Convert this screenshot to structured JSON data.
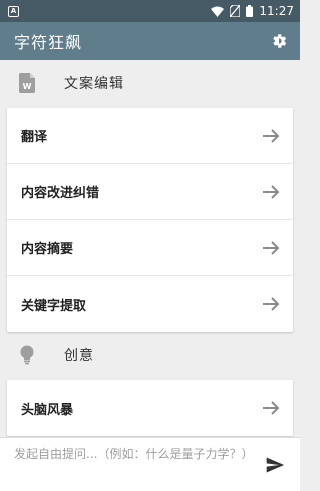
{
  "status_bar": {
    "notification_icon": "A",
    "time": "11:27"
  },
  "app_bar": {
    "title": "字符狂飙",
    "settings_icon": "settings-gear-icon"
  },
  "sections": [
    {
      "title": "文案编辑",
      "icon": "word-document-icon",
      "items": [
        {
          "label": "翻译"
        },
        {
          "label": "内容改进纠错"
        },
        {
          "label": "内容摘要"
        },
        {
          "label": "关键字提取"
        }
      ]
    },
    {
      "title": "创意",
      "icon": "lightbulb-icon",
      "items": [
        {
          "label": "头脑风暴"
        }
      ]
    }
  ],
  "bottom_input": {
    "placeholder": "发起自由提问...（例如：什么是量子力学？）"
  },
  "colors": {
    "status_bar": "#455a64",
    "app_bar": "#607d8b",
    "background": "#eeeeee",
    "icon_gray": "#9e9e9e"
  }
}
